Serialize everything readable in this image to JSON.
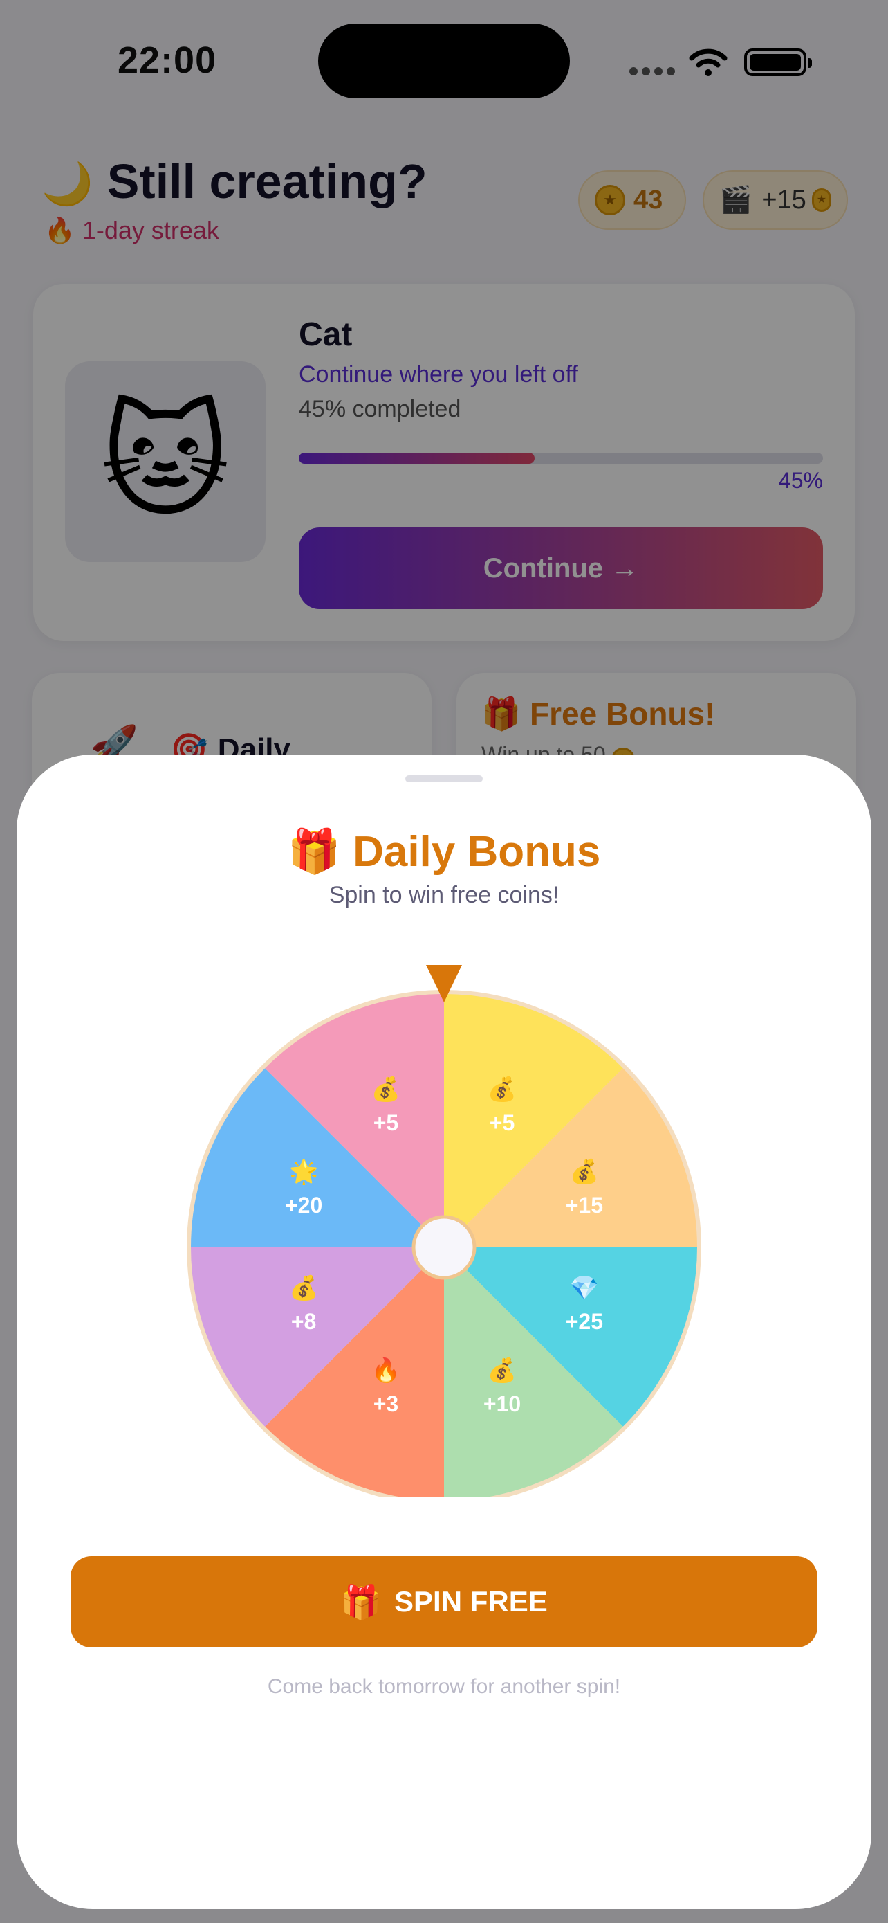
{
  "status_bar": {
    "time": "22:00"
  },
  "header": {
    "icon": "crescent-moon-emoji",
    "title": "Still creating?",
    "streak_text": "1-day streak",
    "coins": "43",
    "reward_label": "+15"
  },
  "continue_card": {
    "name": "Cat",
    "subtitle": "Continue where you left off",
    "progress_text": "45% completed",
    "progress_percent_label": "45%",
    "progress": 0.45,
    "button_label": "Continue →"
  },
  "cards": {
    "left_title": "Daily",
    "right_title": "🎁 Free Bonus!",
    "right_sub": "Win up to 50"
  },
  "sheet": {
    "title": "🎁 Daily Bonus",
    "subtitle": "Spin to win free coins!",
    "spin_button": "SPIN FREE",
    "footnote": "Come back tomorrow for another spin!"
  },
  "wheel": {
    "segments": [
      {
        "label": "+5",
        "emoji": "💰",
        "color": "#FEE25A"
      },
      {
        "label": "+15",
        "emoji": "💰",
        "color": "#FECF8A"
      },
      {
        "label": "+25",
        "emoji": "💎",
        "color": "#55D3E3"
      },
      {
        "label": "+10",
        "emoji": "💰",
        "color": "#ADDEAE"
      },
      {
        "label": "+3",
        "emoji": "🔥",
        "color": "#FE8F6B"
      },
      {
        "label": "+8",
        "emoji": "💰",
        "color": "#D39FE1"
      },
      {
        "label": "+20",
        "emoji": "🌟",
        "color": "#6BB9F7"
      },
      {
        "label": "+5",
        "emoji": "💰",
        "color": "#F49AB9"
      }
    ],
    "rim_color": "#F4DDBF",
    "pointer_color": "#D8760A"
  },
  "colors": {
    "accent_orange": "#D8760A",
    "accent_purple": "#5B2FD6",
    "streak_pink": "#D0306A"
  }
}
